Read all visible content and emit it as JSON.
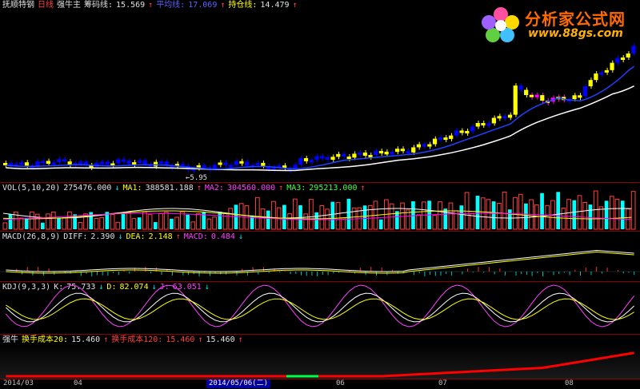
{
  "main_header": {
    "stock_name": "抚顺特钢",
    "period": "日线",
    "indicator": "强牛主",
    "chip_label": "筹码线:",
    "chip_value": "15.569",
    "avg_label": "平均线:",
    "avg_value": "17.069",
    "hold_label": "持仓线:",
    "hold_value": "14.479",
    "price_note": "←5.95"
  },
  "watermark": {
    "title": "分析家公式网",
    "url": "www.88gs.com"
  },
  "vol_header": {
    "label": "VOL(5,10,20)",
    "value": "275476.000",
    "ma1_label": "MA1:",
    "ma1": "388581.188",
    "ma2_label": "MA2:",
    "ma2": "304560.000",
    "ma3_label": "MA3:",
    "ma3": "295213.000"
  },
  "macd_header": {
    "label": "MACD(26,8,9)",
    "diff_label": "DIFF:",
    "diff": "2.390",
    "dea_label": "DEA:",
    "dea": "2.148",
    "macd_label": "MACD:",
    "macd": "0.484"
  },
  "kdj_header": {
    "label": "KDJ(9,3,3)",
    "k_label": "K:",
    "k": "75.733",
    "d_label": "D:",
    "d": "82.074",
    "j_label": "J:",
    "j": "63.051"
  },
  "bull_header": {
    "label": "强牛",
    "cost20_label": "换手成本20:",
    "cost20": "15.460",
    "cost120_label": "换手成本120:",
    "cost120": "15.460",
    "extra": "15.460"
  },
  "timebar": {
    "labels": [
      "2014/03",
      "04",
      "2014/05/06(二)",
      "06",
      "07",
      "08"
    ]
  },
  "colors": {
    "up": "#ffff00",
    "down": "#0000ff",
    "special": "#ff00ff",
    "vol_up": "#ff4040",
    "vol_down": "#00ffff"
  },
  "chart_data": {
    "type": "candlestick",
    "candles_count": 118,
    "note_low": "5.95"
  }
}
